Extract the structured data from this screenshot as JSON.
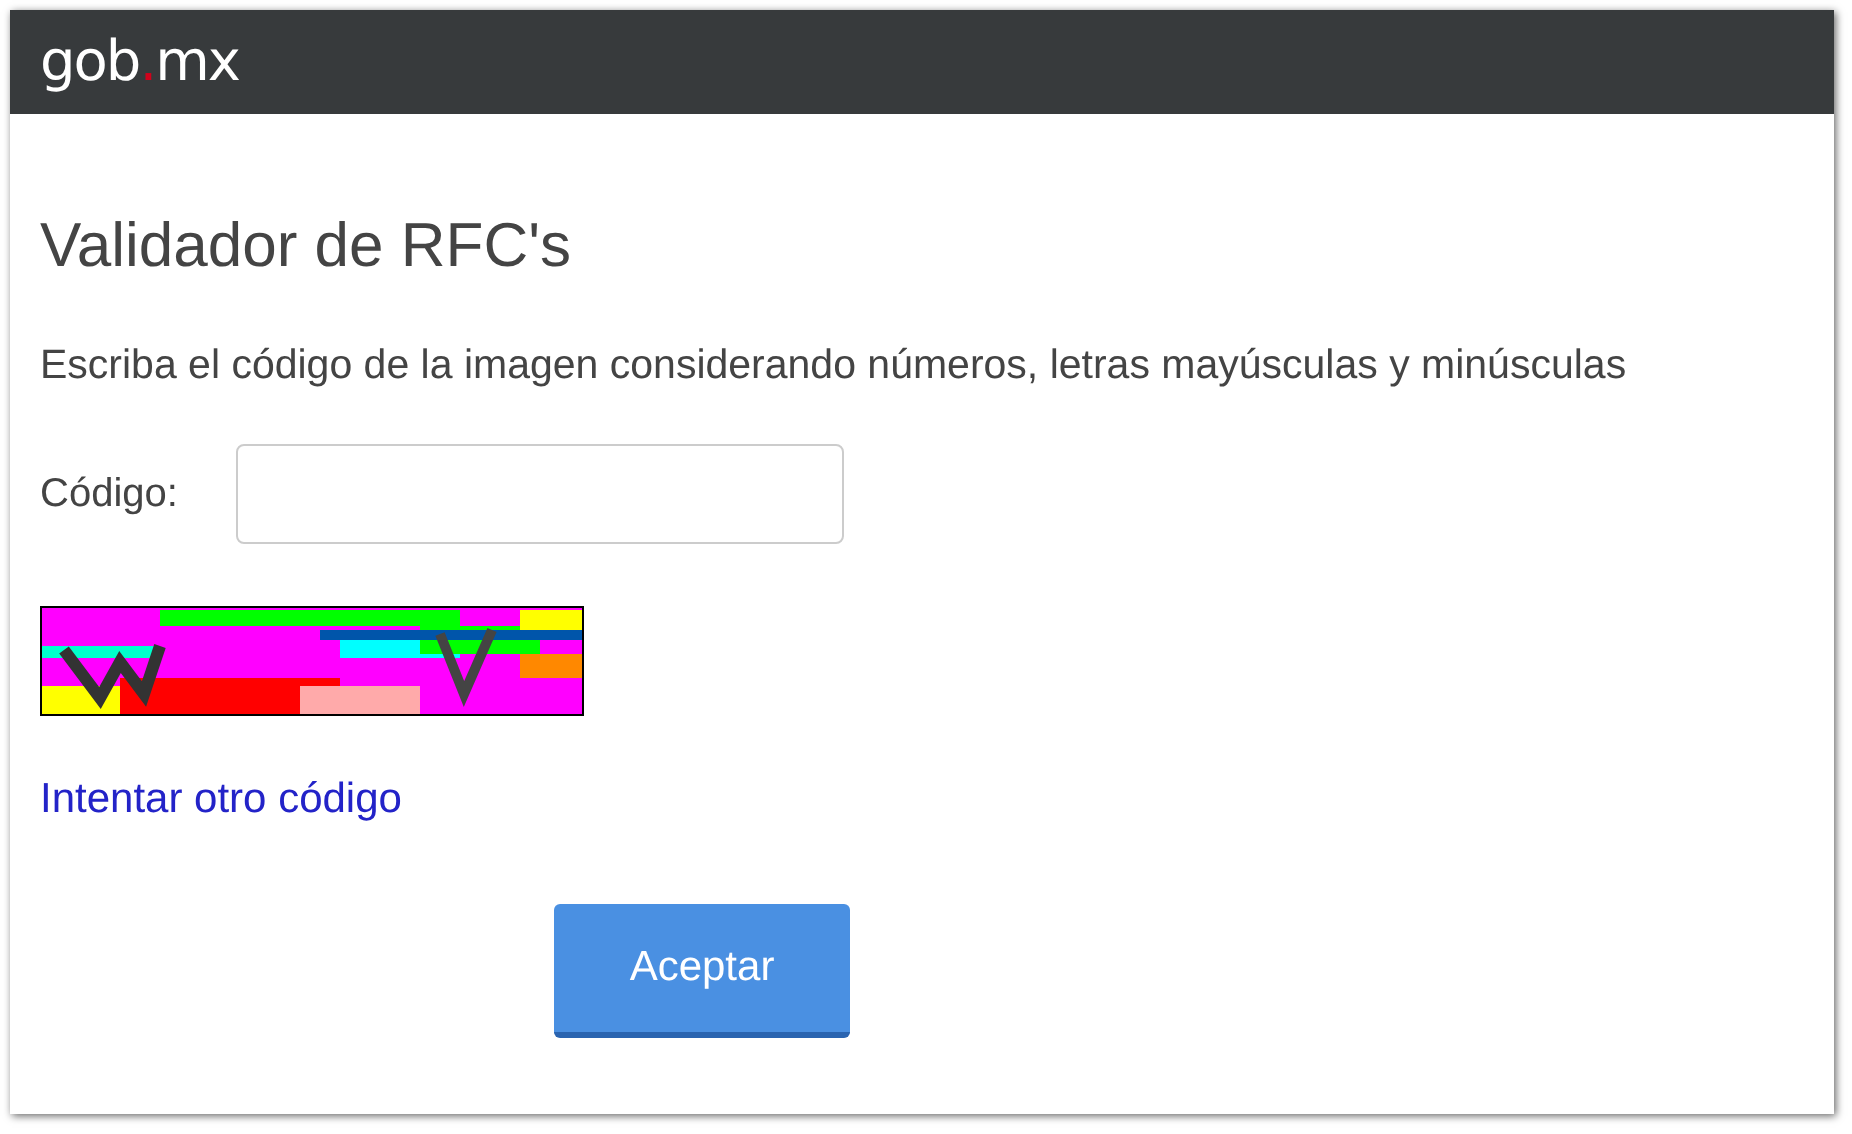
{
  "header": {
    "logo_parts": [
      {
        "text": "gob",
        "accent": false
      },
      {
        "text": ".",
        "accent": true
      },
      {
        "text": "mx",
        "accent": false
      }
    ]
  },
  "title": "Validador de RFC's",
  "instructions": "Escriba el código de la imagen considerando números, letras mayúsculas y minúsculas",
  "code_field": {
    "label": "Código:"
  },
  "retry_link": "Intentar otro código",
  "submit_button": "Aceptar"
}
